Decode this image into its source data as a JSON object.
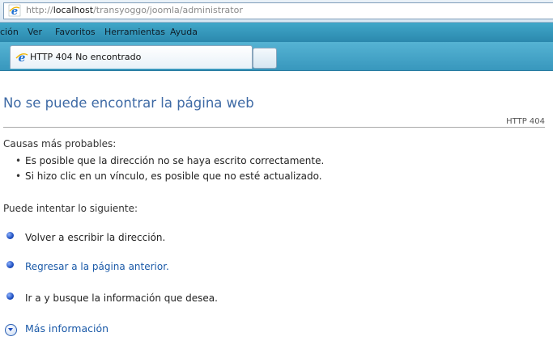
{
  "browser": {
    "address": {
      "prefix": "http://",
      "host": "localhost",
      "path": "/transyoggo/joomla/administrator"
    },
    "menu": [
      "ción",
      "Ver",
      "Favoritos",
      "Herramientas",
      "Ayuda"
    ],
    "tab": {
      "label": "HTTP 404 No encontrado"
    }
  },
  "page": {
    "title": "No se puede encontrar la página web",
    "code": "HTTP 404",
    "causes_heading": "Causas más probables:",
    "causes": [
      "Es posible que la dirección no se haya escrito correctamente.",
      "Si hizo clic en un vínculo, es posible que no esté actualizado."
    ],
    "try_heading": "Puede intentar lo siguiente:",
    "suggestions": [
      "Volver a escribir la dirección.",
      "Regresar a la página anterior.",
      "Ir a  y busque la información que desea."
    ],
    "more_info": "Más información"
  }
}
